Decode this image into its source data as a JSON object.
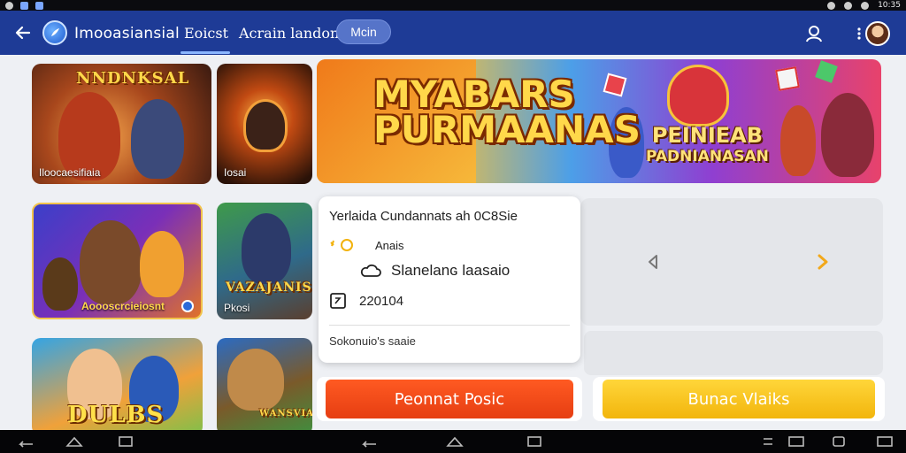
{
  "status_bar": {
    "time": "10:35",
    "icons": [
      "notification-icon",
      "app-icon",
      "signal-icon",
      "wifi-icon",
      "battery-icon"
    ]
  },
  "app_bar": {
    "title": "Imooasiansial",
    "tabs": [
      {
        "label": "Eoicst",
        "active": true
      },
      {
        "label": "Acrain landon"
      }
    ],
    "pill_button": "Mcin",
    "icons": [
      "back-arrow-icon",
      "app-logo-icon",
      "user-icon",
      "more-vert-icon",
      "avatar"
    ]
  },
  "tiles": [
    {
      "logo": "NNDNKSAL",
      "label": "Iloocaesifiaia"
    },
    {
      "logo": "",
      "label": "Iosai"
    },
    {
      "logo": "",
      "label": "Aoooscrcieiosnt"
    },
    {
      "logo": "VAZAJANIS",
      "label": "Pkosi"
    },
    {
      "logo": "DULBS",
      "label": ""
    },
    {
      "logo": "WANSVIANA",
      "label": ""
    }
  ],
  "banner": {
    "title_line1": "MYABARS",
    "title_line2": "PURMAANAS",
    "subtitle_line1": "PEINIEAB",
    "subtitle_line2": "PADNIANASAN"
  },
  "info_card": {
    "title": "Yerlaida Cundannats ah 0C8Sie",
    "row1": "Anais",
    "row2": "Slanelanɢ laasaio",
    "row3": "220104",
    "footer": "Sokonuio's saaie"
  },
  "buttons": {
    "primary": "Peonnat Posic",
    "secondary": "Bunac Vlaiks"
  },
  "colors": {
    "app_bar": "#1e3b96",
    "primary_button": "#f04a1a",
    "secondary_button": "#f5c21c",
    "carousel_next": "#f2a81a"
  }
}
